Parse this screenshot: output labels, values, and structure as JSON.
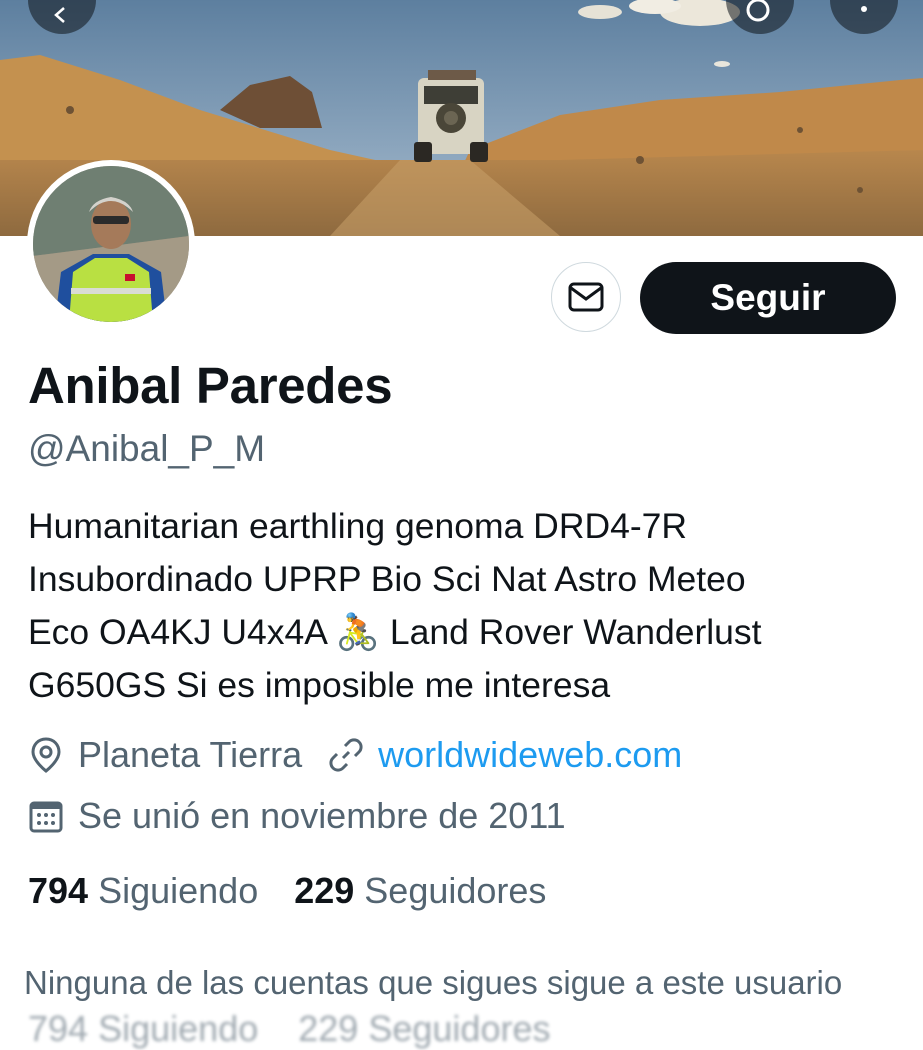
{
  "profile": {
    "display_name": "Anibal Paredes",
    "handle": "@Anibal_P_M",
    "bio_lines": [
      "Humanitarian earthling genoma DRD4-7R",
      "Insubordinado UPRP Bio Sci Nat Astro Meteo",
      "Eco OA4KJ U4x4A 🚴 Land Rover Wanderlust",
      "G650GS Si es imposible me interesa"
    ],
    "location": "Planeta Tierra",
    "website": "worldwideweb.com",
    "joined": "Se unió en noviembre de 2011"
  },
  "actions": {
    "follow_label": "Seguir",
    "message_icon": "envelope-icon"
  },
  "stats": {
    "following_count": "794",
    "following_label": "Siguiendo",
    "followers_count": "229",
    "followers_label": "Seguidores"
  },
  "notice": "Ninguna de las cuentas que sigues sigue a este usuario",
  "icons": {
    "back": "arrow-left-icon",
    "search": "search-icon",
    "more": "more-vertical-icon",
    "location": "map-pin-icon",
    "link": "link-icon",
    "calendar": "calendar-icon"
  },
  "colors": {
    "primary_text": "#0f1419",
    "secondary_text": "#536471",
    "link": "#1d9bf0",
    "follow_button": "#0f1419"
  }
}
